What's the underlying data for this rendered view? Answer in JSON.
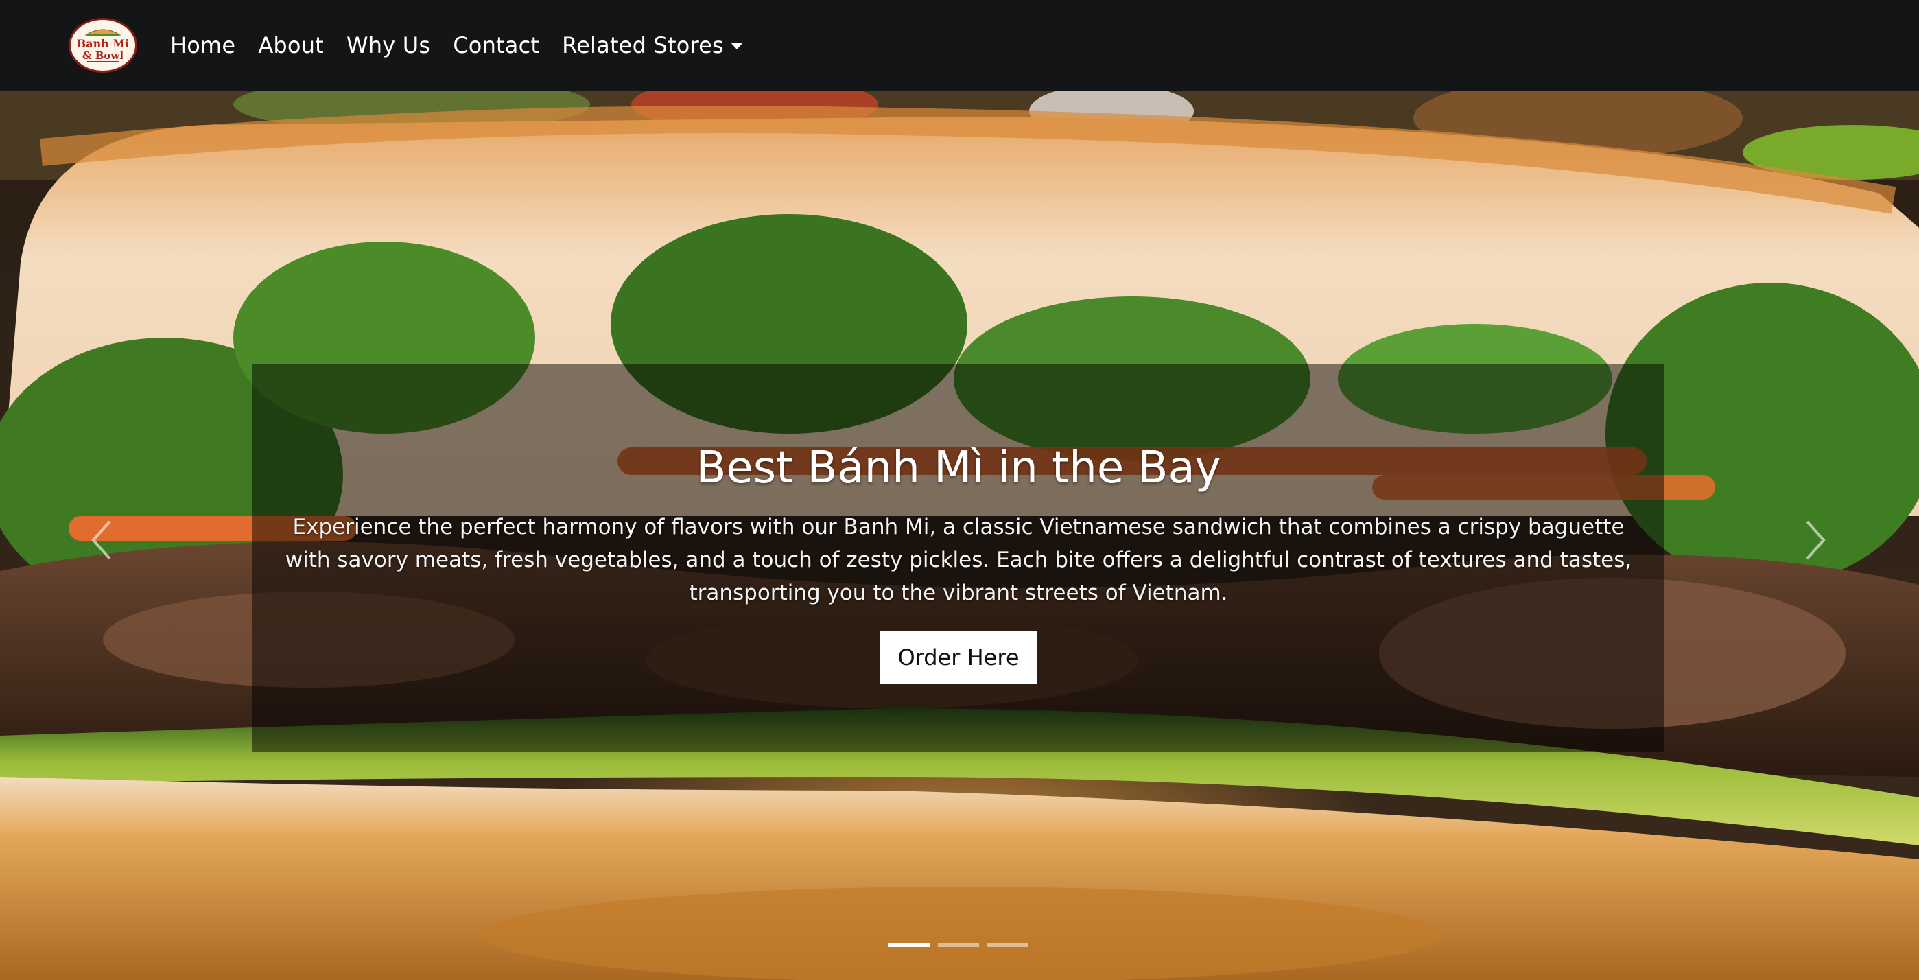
{
  "brand": {
    "logo_line1": "Banh Mi",
    "logo_line2": "& Bowl",
    "logo_icon": "banh-mi-bowl-logo"
  },
  "nav": {
    "items": [
      {
        "label": "Home"
      },
      {
        "label": "About"
      },
      {
        "label": "Why Us"
      },
      {
        "label": "Contact"
      }
    ],
    "dropdown": {
      "label": "Related Stores",
      "icon": "caret-down-icon"
    }
  },
  "hero": {
    "title": "Best Bánh Mì in the Bay",
    "description": "Experience the perfect harmony of flavors with our Banh Mi, a classic Vietnamese sandwich that combines a crispy baguette with savory meats, fresh vegetables, and a touch of zesty pickles. Each bite offers a delightful contrast of textures and tastes, transporting you to the vibrant streets of Vietnam.",
    "cta_label": "Order Here",
    "prev_icon": "chevron-left-icon",
    "next_icon": "chevron-right-icon",
    "slides_total": 3,
    "active_slide": 1
  },
  "colors": {
    "navbar_bg": "#141516",
    "button_bg": "#ffffff",
    "logo_accent": "#b0241a"
  }
}
